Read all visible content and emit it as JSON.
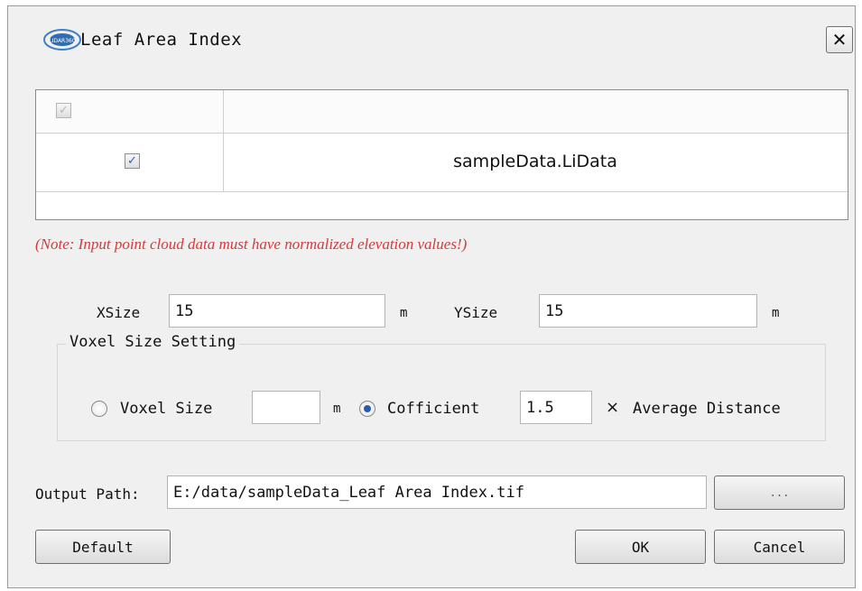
{
  "window": {
    "title": "Leaf Area Index",
    "logo_text": "LIDAR360",
    "close_icon": "close-icon"
  },
  "table": {
    "header_checkbox_checked": true,
    "header_checkbox_enabled": false,
    "rows": [
      {
        "checked": true,
        "name": "sampleData.LiData"
      }
    ]
  },
  "note": "(Note: Input point cloud data must have normalized elevation values!)",
  "size": {
    "x_label": "XSize",
    "x_value": "15",
    "x_unit": "m",
    "y_label": "YSize",
    "y_value": "15",
    "y_unit": "m"
  },
  "voxel": {
    "group_title": "Voxel Size Setting",
    "voxel_size_label": "Voxel Size",
    "voxel_size_value": "",
    "voxel_size_unit": "m",
    "voxel_size_selected": false,
    "coefficient_label": "Cofficient",
    "coefficient_value": "1.5",
    "coefficient_selected": true,
    "multiply_symbol": "×",
    "average_distance_label": "Average Distance"
  },
  "output": {
    "label": "Output Path:",
    "value": "E:/data/sampleData_Leaf Area Index.tif",
    "browse_label": "..."
  },
  "buttons": {
    "default": "Default",
    "ok": "OK",
    "cancel": "Cancel"
  },
  "colors": {
    "note_red": "#d23b3b",
    "dialog_bg": "#f0f0f0",
    "radio_selected": "#2a5aa8"
  }
}
